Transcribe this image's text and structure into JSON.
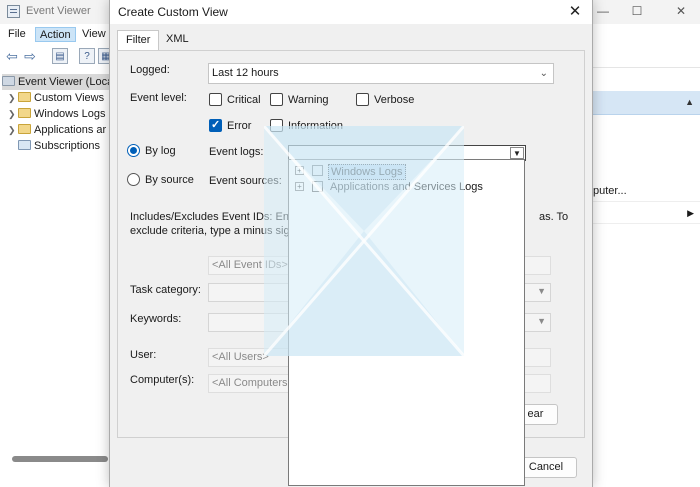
{
  "bg_window": {
    "title": "Event Viewer",
    "menu": [
      "File",
      "Action",
      "View"
    ],
    "tree": [
      {
        "label": "Event Viewer (Local",
        "selected": true
      },
      {
        "label": "Custom Views"
      },
      {
        "label": "Windows Logs"
      },
      {
        "label": "Applications ar"
      },
      {
        "label": "Subscriptions"
      }
    ],
    "right_pane_items": [
      "puter...",
      ""
    ]
  },
  "dialog": {
    "title": "Create Custom View",
    "tabs": [
      "Filter",
      "XML"
    ],
    "logged_label": "Logged:",
    "logged_value": "Last 12 hours",
    "event_level_label": "Event level:",
    "levels": {
      "critical": {
        "label": "Critical",
        "checked": false
      },
      "warning": {
        "label": "Warning",
        "checked": false
      },
      "verbose": {
        "label": "Verbose",
        "checked": false
      },
      "error": {
        "label": "Error",
        "checked": true
      },
      "information": {
        "label": "Information",
        "checked": false
      }
    },
    "by_log_label": "By log",
    "by_source_label": "By source",
    "event_logs_label": "Event logs:",
    "event_sources_label": "Event sources:",
    "includes_text_line1": "Includes/Excludes Event IDs: Enter",
    "includes_text_line1_tail": "as. To",
    "includes_text_line2": "exclude criteria, type a minus sign",
    "event_ids_placeholder": "<All Event IDs>",
    "task_category_label": "Task category:",
    "keywords_label": "Keywords:",
    "user_label": "User:",
    "user_placeholder": "<All Users>",
    "computers_label": "Computer(s):",
    "computers_placeholder": "<All Computers>",
    "clear_button": "ear",
    "cancel_button": "Cancel"
  },
  "dropdown": {
    "items": [
      {
        "label": "Windows Logs",
        "checked": false,
        "highlighted": true
      },
      {
        "label": "Applications and Services Logs",
        "checked": false,
        "highlighted": false
      }
    ]
  },
  "colors": {
    "accent": "#005fb8",
    "selection": "#cce4f7"
  }
}
